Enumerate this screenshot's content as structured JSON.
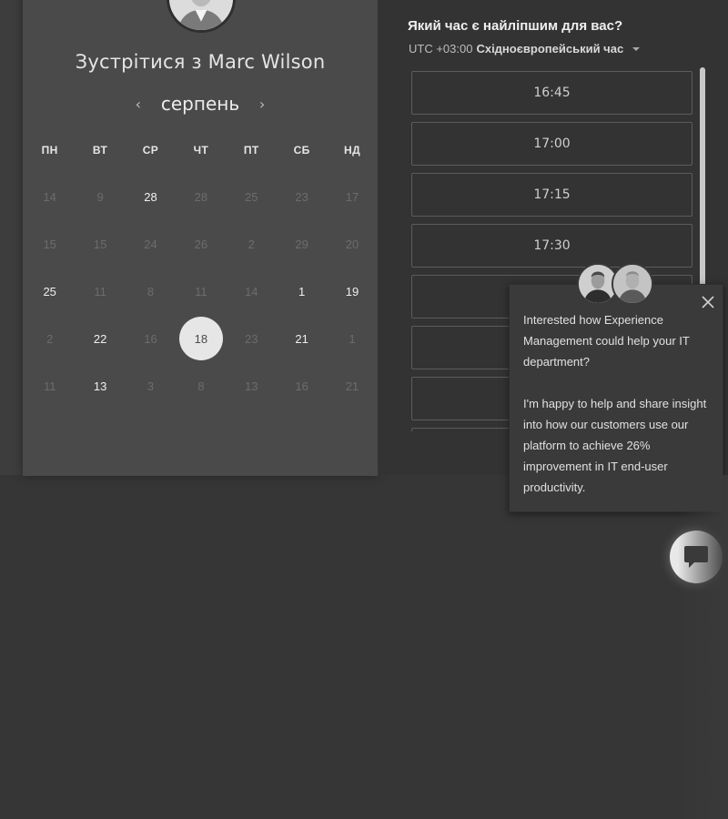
{
  "host": {
    "title_prefix": "Зустрітися з ",
    "name": "Marc Wilson"
  },
  "calendar": {
    "month": "серпень",
    "prev_icon": "chevron-left-icon",
    "next_icon": "chevron-right-icon",
    "weekdays": [
      "ПН",
      "ВТ",
      "СР",
      "ЧТ",
      "ПТ",
      "СБ",
      "НД"
    ],
    "weeks": [
      [
        {
          "d": "14",
          "s": "off"
        },
        {
          "d": "9",
          "s": "off"
        },
        {
          "d": "28",
          "s": "on"
        },
        {
          "d": "28",
          "s": "off"
        },
        {
          "d": "25",
          "s": "off"
        },
        {
          "d": "23",
          "s": "off"
        },
        {
          "d": "17",
          "s": "off"
        }
      ],
      [
        {
          "d": "15",
          "s": "off"
        },
        {
          "d": "15",
          "s": "off"
        },
        {
          "d": "24",
          "s": "off"
        },
        {
          "d": "26",
          "s": "off"
        },
        {
          "d": "2",
          "s": "off"
        },
        {
          "d": "29",
          "s": "off"
        },
        {
          "d": "20",
          "s": "off"
        }
      ],
      [
        {
          "d": "25",
          "s": "on"
        },
        {
          "d": "11",
          "s": "off"
        },
        {
          "d": "8",
          "s": "off"
        },
        {
          "d": "11",
          "s": "off"
        },
        {
          "d": "14",
          "s": "off"
        },
        {
          "d": "1",
          "s": "on"
        },
        {
          "d": "19",
          "s": "on"
        }
      ],
      [
        {
          "d": "2",
          "s": "off"
        },
        {
          "d": "22",
          "s": "on"
        },
        {
          "d": "16",
          "s": "off"
        },
        {
          "d": "18",
          "s": "sel"
        },
        {
          "d": "23",
          "s": "off"
        },
        {
          "d": "21",
          "s": "on"
        },
        {
          "d": "1",
          "s": "off"
        }
      ],
      [
        {
          "d": "11",
          "s": "off"
        },
        {
          "d": "13",
          "s": "on"
        },
        {
          "d": "3",
          "s": "off"
        },
        {
          "d": "8",
          "s": "off"
        },
        {
          "d": "13",
          "s": "off"
        },
        {
          "d": "16",
          "s": "off"
        },
        {
          "d": "21",
          "s": "off"
        }
      ]
    ]
  },
  "times": {
    "question": "Який час є найліпшим для вас?",
    "tz_offset": "UTC +03:00",
    "tz_name": "Східноєвропейський час",
    "tz_caret_icon": "caret-down-icon",
    "slots": [
      "16:45",
      "17:00",
      "17:15",
      "17:30",
      "",
      "",
      "",
      ""
    ]
  },
  "chat": {
    "message_1": "Interested how Experience Management could help your IT department?",
    "message_2": "I'm happy to help and share insight into how our customers use our platform to achieve 26% improvement in IT end-user productivity.",
    "close_icon": "close-icon",
    "launcher_icon": "chat-bubble-icon"
  },
  "colors": {
    "background": "#363636",
    "card": "#4a4a4a",
    "panel": "#333333",
    "selected_day": "#e6e6e6"
  }
}
